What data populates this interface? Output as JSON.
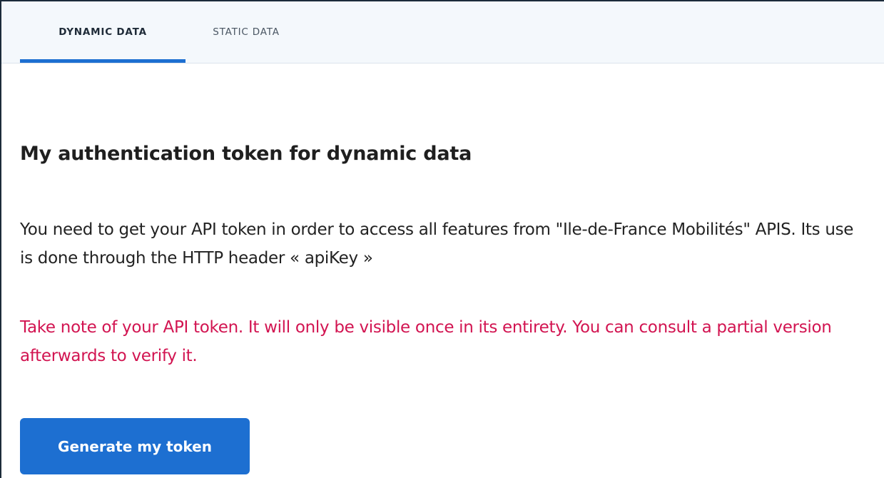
{
  "tabs": {
    "dynamic_label": "DYNAMIC DATA",
    "static_label": "STATIC DATA",
    "active": "DYNAMIC DATA"
  },
  "main": {
    "title": "My authentication token for dynamic data",
    "description": "You need to get your API token in order to access all features from \"Ile-de-France Mobilités\" APIS. Its use is done through the HTTP header « apiKey »",
    "warning": "Take note of your API token. It will only be visible once in its entirety. You can consult a partial version afterwards to verify it.",
    "generate_button_label": "Generate my token"
  },
  "colors": {
    "accent": "#1d6fd1",
    "warning": "#d21451",
    "tabbar_background": "#f4f8fc"
  }
}
